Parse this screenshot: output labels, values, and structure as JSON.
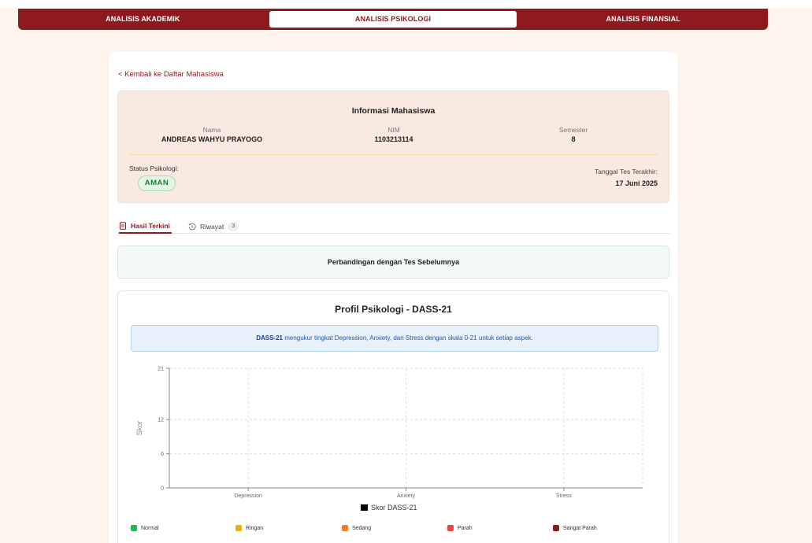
{
  "nav": {
    "items": [
      {
        "label": "ANALISIS AKADEMIK",
        "active": false
      },
      {
        "label": "ANALISIS PSIKOLOGI",
        "active": true
      },
      {
        "label": "ANALISIS FINANSIAL",
        "active": false
      }
    ]
  },
  "back_link": "< Kembali ke Daftar Mahasiswa",
  "info": {
    "title": "Informasi Mahasiswa",
    "nama_label": "Nama",
    "nama_value": "ANDREAS WAHYU PRAYOGO",
    "nim_label": "NIM",
    "nim_value": "1103213114",
    "semester_label": "Semester",
    "semester_value": "8",
    "status_label": "Status Psikologi:",
    "status_value": "AMAN",
    "date_label": "Tanggal Tes Terakhir:",
    "date_value": "17 Juni 2025"
  },
  "tabs": {
    "current_label": "Hasil Terkini",
    "history_label": "Riwayat",
    "history_count": "3"
  },
  "compare": {
    "title": "Perbandingan dengan Tes Sebelumnya"
  },
  "chart_section": {
    "title": "Profil Psikologi - DASS-21",
    "note_bold": "DASS-21",
    "note_text": " mengukur tingkat Depression, Anxiety, dan Stress dengan skala 0-21 untuk setiap aspek."
  },
  "chart_data": {
    "type": "bar",
    "categories": [
      "Depression",
      "Anxiety",
      "Stress"
    ],
    "series": [
      {
        "name": "Skor DASS-21",
        "values": [
          0,
          0,
          0
        ]
      }
    ],
    "ylabel": "Skor",
    "yticks": [
      0,
      6,
      12,
      21
    ],
    "ylim": [
      0,
      21
    ],
    "grid": true,
    "legend": "bottom"
  },
  "severity_legend": [
    {
      "label": "Normal",
      "color": "#22b455"
    },
    {
      "label": "Ringan",
      "color": "#e2b114"
    },
    {
      "label": "Sedang",
      "color": "#f27c22"
    },
    {
      "label": "Parah",
      "color": "#e8473f"
    },
    {
      "label": "Sangat Parah",
      "color": "#8c1a1f"
    }
  ],
  "colors": {
    "primary": "#8c1a1f",
    "status_ok": "#1f7a3c",
    "page_bg": "#fdf5ec"
  }
}
